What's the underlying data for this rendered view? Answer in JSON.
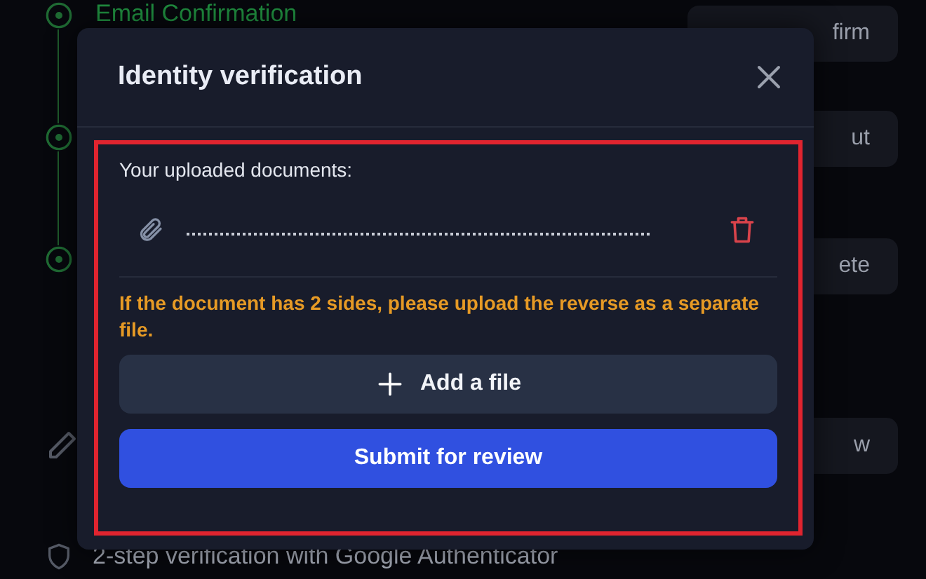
{
  "background": {
    "steps": [
      {
        "title": "Email Confirmation",
        "action": "firm"
      },
      {
        "action": "ut"
      },
      {
        "action": "ete"
      }
    ],
    "edit_action": "w",
    "footer_item": "2-step verification with Google Authenticator"
  },
  "dialog": {
    "title": "Identity verification",
    "section_label": "Your uploaded documents:",
    "files": [
      {
        "kind": "obscured"
      }
    ],
    "notice": "If the document has 2 sides, please upload the reverse as a separate file.",
    "add_button": "Add a file",
    "submit_button": "Submit for review",
    "highlighted": true
  }
}
